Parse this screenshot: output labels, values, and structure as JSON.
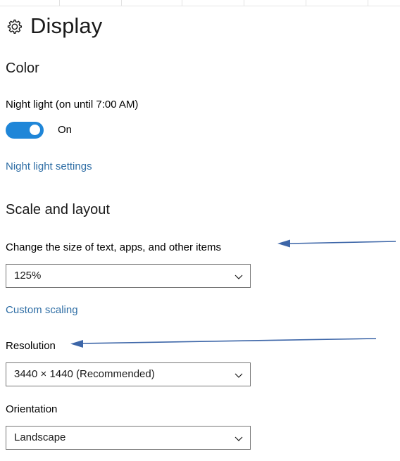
{
  "page": {
    "icon": "gear-icon",
    "title": "Display"
  },
  "sections": {
    "color": {
      "heading": "Color",
      "night_light": {
        "label": "Night light (on until 7:00 AM)",
        "toggle_state": "On",
        "toggle_on": true,
        "settings_link": "Night light settings"
      }
    },
    "scale_and_layout": {
      "heading": "Scale and layout",
      "scale": {
        "label": "Change the size of text, apps, and other items",
        "value": "125%",
        "chevron": "chevron-down-icon",
        "custom_scaling_link": "Custom scaling"
      },
      "resolution": {
        "label": "Resolution",
        "value": "3440 × 1440 (Recommended)",
        "chevron": "chevron-down-icon"
      },
      "orientation": {
        "label": "Orientation",
        "value": "Landscape",
        "chevron": "chevron-down-icon"
      }
    }
  },
  "annotations": [
    {
      "name": "arrow-pointing-to-scale-label",
      "direction": "left"
    },
    {
      "name": "arrow-pointing-to-resolution-label",
      "direction": "left"
    }
  ],
  "colors": {
    "accent": "#1f86d8",
    "link": "#2f6ea5",
    "annotation": "#3d66a8",
    "combo_border": "#767676",
    "text": "#000000"
  }
}
